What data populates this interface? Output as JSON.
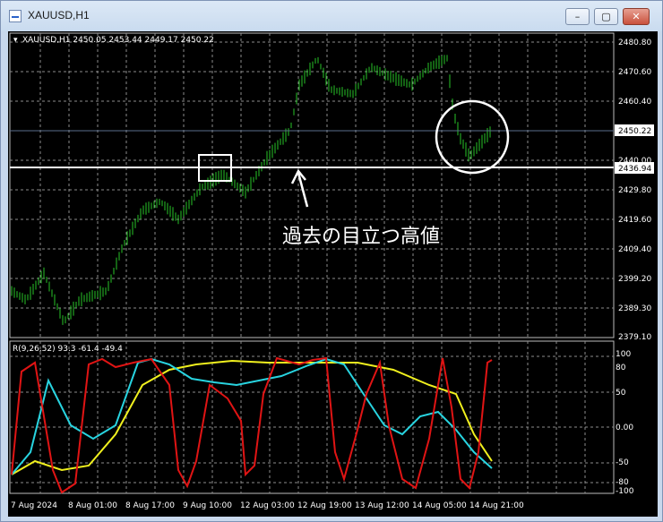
{
  "window": {
    "title": "XAUUSD,H1",
    "minimize_glyph": "–",
    "maximize_glyph": "▢",
    "close_glyph": "✕"
  },
  "chart": {
    "header": "XAUUSD,H1  2450.05 2453.44 2449.17 2450.22",
    "price_labels": [
      "2480.80",
      "2470.60",
      "2460.40",
      "2450.22",
      "2440.00",
      "2436.94",
      "2429.80",
      "2419.60",
      "2409.40",
      "2399.20",
      "2389.30",
      "2379.10"
    ],
    "current_price": "2450.22",
    "horizontal_line_price": "2436.94",
    "annotation": "過去の目立つ高値",
    "colors": {
      "bull": "#29c429",
      "background": "#000000",
      "grid": "#8c8c8c",
      "annotation": "#ffffff",
      "hline": "#ffffff"
    }
  },
  "indicator": {
    "header": "R(9,26,52) 93.3 -61.4 -49.4",
    "levels": [
      "100",
      "80",
      "50",
      "0.00",
      "-50",
      "-80",
      "-100"
    ],
    "series_colors": {
      "fast": "#e01414",
      "mid": "#28d4e0",
      "slow": "#f0f01e"
    }
  },
  "time_axis": [
    "7 Aug 2024",
    "8 Aug 01:00",
    "8 Aug 17:00",
    "9 Aug 10:00",
    "12 Aug 03:00",
    "12 Aug 19:00",
    "13 Aug 12:00",
    "14 Aug 05:00",
    "14 Aug 21:00"
  ]
}
